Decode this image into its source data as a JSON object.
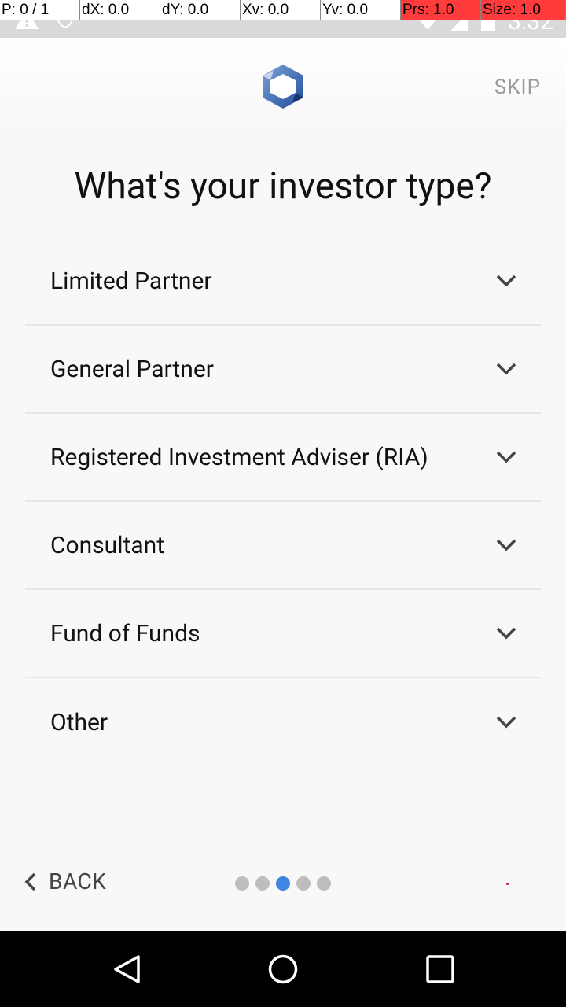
{
  "debug": {
    "pointer": "P: 0 / 1",
    "dx": "dX: 0.0",
    "dy": "dY: 0.0",
    "xv": "Xv: 0.0",
    "yv": "Yv: 0.0",
    "prs": "Prs: 1.0",
    "size": "Size: 1.0"
  },
  "status": {
    "time": "3:32"
  },
  "header": {
    "skip_label": "SKIP"
  },
  "title": "What's your investor type?",
  "options": [
    {
      "label": "Limited Partner"
    },
    {
      "label": "General Partner"
    },
    {
      "label": "Registered Investment Adviser (RIA)"
    },
    {
      "label": "Consultant"
    },
    {
      "label": "Fund of Funds"
    },
    {
      "label": "Other"
    }
  ],
  "footer": {
    "back_label": "BACK",
    "page_indicator": {
      "total": 5,
      "current": 3
    }
  },
  "colors": {
    "accent": "#3f86e0",
    "dot_inactive": "#bdbdbd",
    "debug_highlight": "#ff3b3b",
    "logo_blue": "#2f5aa8"
  },
  "icons": {
    "status_left": [
      "warning-icon",
      "shield-icon"
    ],
    "status_right": [
      "wifi-icon",
      "signal-icon",
      "battery-icon"
    ],
    "option_expand": "chevron-down-icon",
    "back": "chevron-left-icon",
    "nav": [
      "nav-back-icon",
      "nav-home-icon",
      "nav-recents-icon"
    ]
  }
}
